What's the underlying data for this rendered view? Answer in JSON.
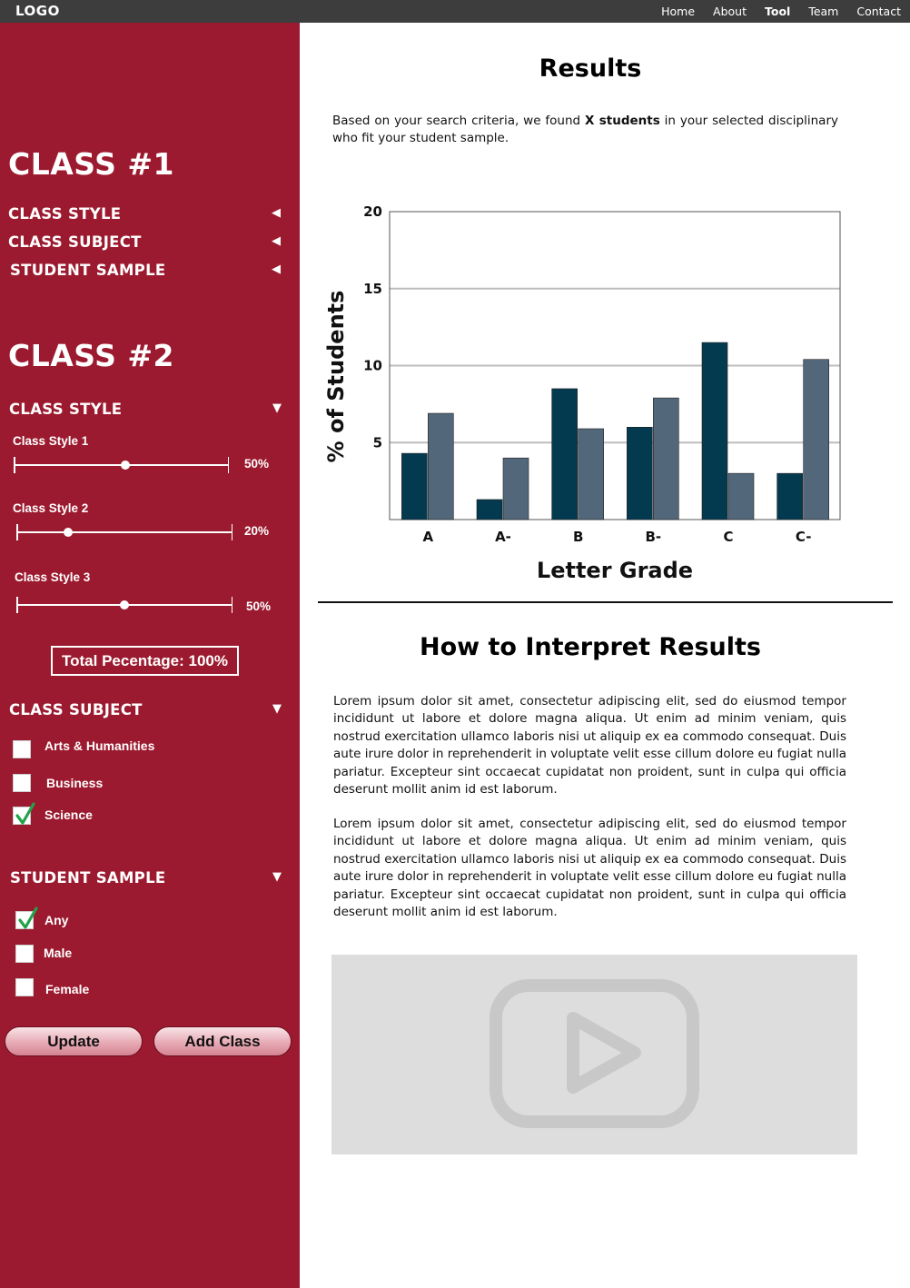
{
  "nav": {
    "logo": "LOGO",
    "items": [
      {
        "label": "Home",
        "active": false
      },
      {
        "label": "About",
        "active": false
      },
      {
        "label": "Tool",
        "active": true
      },
      {
        "label": "Team",
        "active": false
      },
      {
        "label": "Contact",
        "active": false
      }
    ]
  },
  "sidebar": {
    "class1": {
      "title": "CLASS #1",
      "sections": [
        {
          "label": "CLASS STYLE",
          "arrow": "◀"
        },
        {
          "label": "CLASS SUBJECT",
          "arrow": "◀"
        },
        {
          "label": "STUDENT SAMPLE",
          "arrow": "◀"
        }
      ]
    },
    "class2": {
      "title": "CLASS #2",
      "style_section": {
        "label": "CLASS STYLE",
        "arrow": "▼"
      },
      "sliders": [
        {
          "label": "Class Style 1",
          "value_text": "50%",
          "fraction": 0.52
        },
        {
          "label": "Class Style 2",
          "value_text": "20%",
          "fraction": 0.24
        },
        {
          "label": "Class Style 3",
          "value_text": "50%",
          "fraction": 0.5
        }
      ],
      "total": "Total Pecentage: 100%",
      "subject_section": {
        "label": "CLASS SUBJECT",
        "arrow": "▼"
      },
      "subjects": [
        {
          "label": "Arts & Humanities",
          "checked": false
        },
        {
          "label": "Business",
          "checked": false
        },
        {
          "label": "Science",
          "checked": true
        }
      ],
      "sample_section": {
        "label": "STUDENT SAMPLE",
        "arrow": "▼"
      },
      "samples": [
        {
          "label": "Any",
          "checked": true
        },
        {
          "label": "Male",
          "checked": false
        },
        {
          "label": "Female",
          "checked": false
        }
      ]
    },
    "buttons": {
      "update": "Update",
      "add_class": "Add Class"
    }
  },
  "main": {
    "results_title": "Results",
    "intro_pre": "Based on your search criteria, we found ",
    "intro_bold": "X students",
    "intro_post": " in your selected disciplinary who fit your student sample.",
    "interpret_title": "How to Interpret Results",
    "paragraphs": [
      "Lorem ipsum dolor sit amet, consectetur adipiscing elit, sed do eiusmod tempor incididunt ut labore et dolore magna aliqua. Ut enim ad minim veniam, quis nostrud exercitation ullamco laboris nisi ut aliquip ex ea commodo consequat. Duis aute irure dolor in reprehenderit in voluptate velit esse cillum dolore eu fugiat nulla pariatur. Excepteur sint occaecat cupidatat non proident, sunt in culpa qui officia deserunt mollit anim id est laborum.",
      "Lorem ipsum dolor sit amet, consectetur adipiscing elit, sed do eiusmod tempor incididunt ut labore et dolore magna aliqua. Ut enim ad minim veniam, quis nostrud exercitation ullamco laboris nisi ut aliquip ex ea commodo consequat. Duis aute irure dolor in reprehenderit in voluptate velit esse cillum dolore eu fugiat nulla pariatur. Excepteur sint occaecat cupidatat non proident, sunt in culpa qui officia deserunt mollit anim id est laborum."
    ],
    "video_icon": "play-video-icon"
  },
  "colors": {
    "topbar": "#3d3d3d",
    "sidebar": "#9c1a2f",
    "series1": "#043a4f",
    "series2": "#52677a",
    "gridline": "#bdbdbd",
    "video_bg": "#dddddd",
    "check": "#22a34a"
  },
  "chart_data": {
    "type": "bar",
    "categories": [
      "A",
      "A-",
      "B",
      "B-",
      "C",
      "C-"
    ],
    "series": [
      {
        "values": [
          4.3,
          1.3,
          8.5,
          6.0,
          11.5,
          3.0
        ]
      },
      {
        "values": [
          6.9,
          4.0,
          5.9,
          7.9,
          3.0,
          10.4
        ]
      }
    ],
    "xlabel": "Letter Grade",
    "ylabel": "% of Students",
    "ylim": [
      0,
      20
    ],
    "yticks": [
      5,
      10,
      15,
      20
    ],
    "grid": true
  }
}
